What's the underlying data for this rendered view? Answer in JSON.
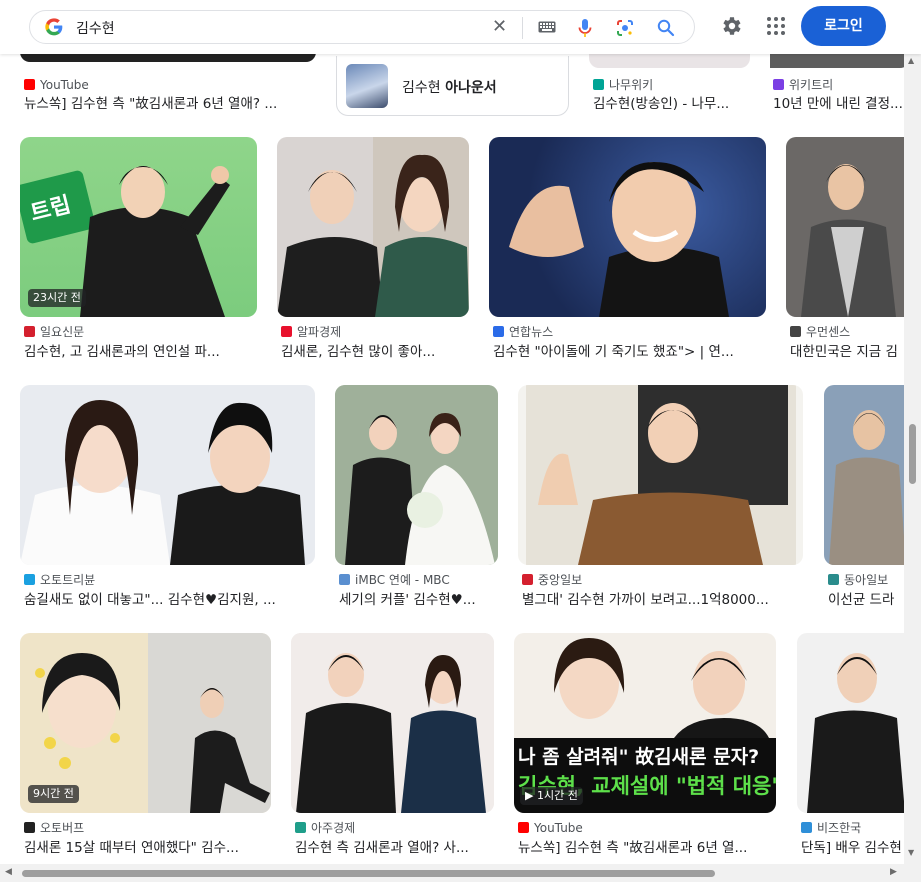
{
  "search": {
    "query": "김수현",
    "login_label": "로그인"
  },
  "related_card": {
    "name": "김수현",
    "suffix": "아나운서"
  },
  "tiles": [
    {
      "source": "YouTube",
      "title": "뉴스쏙] 김수현 측 \"故김새론과 6년 열애? ...",
      "fav_color": "#ff0000"
    },
    {
      "source": "나무위키",
      "title": "김수현(방송인) - 나무...",
      "fav_color": "#00a495"
    },
    {
      "source": "위키트리",
      "title": "10년 만에 내린 결정...",
      "fav_color": "#7b3fe4"
    },
    {
      "source": "일요신문",
      "title": "김수현, 고 김새론과의 연인설 파...",
      "fav_color": "#d4202e",
      "badge": "23시간 전"
    },
    {
      "source": "알파경제",
      "title": "김새론, 김수현 많이 좋아...",
      "fav_color": "#e8112d"
    },
    {
      "source": "연합뉴스",
      "title": "김수현 \"아이돌에 기 죽기도 했죠\"> | 연...",
      "fav_color": "#2b6be8"
    },
    {
      "source": "우먼센스",
      "title": "대한민국은 지금 김",
      "fav_color": "#444444"
    },
    {
      "source": "오토트리뷴",
      "title": "숨길새도 없이 대놓고\"... 김수현♥김지원, ...",
      "fav_color": "#1aa0e0"
    },
    {
      "source": "iMBC 연예 - MBC",
      "title": "세기의 커플' 김수현♥...",
      "fav_color": "#5a8fd0"
    },
    {
      "source": "중앙일보",
      "title": "별그대' 김수현 가까이 보려고...1억8000...",
      "fav_color": "#d4202e"
    },
    {
      "source": "동아일보",
      "title": "이선균 드라",
      "fav_color": "#2a8c8c"
    },
    {
      "source": "오토버프",
      "title": "김새론 15살 때부터 연애했다\" 김수...",
      "fav_color": "#222222",
      "badge": "9시간 전"
    },
    {
      "source": "아주경제",
      "title": "김수현 측 김새론과 열애? 사...",
      "fav_color": "#1f9e8a"
    },
    {
      "source": "YouTube",
      "title": "뉴스쏙] 김수현 측 \"故김새론과 6년 열...",
      "fav_color": "#ff0000",
      "badge": "1시간 전"
    },
    {
      "source": "비즈한국",
      "title": "단독] 배우 김수현",
      "fav_color": "#2f8fd8"
    }
  ],
  "thumb_texts": {
    "caption_top": "나 좀 살려줘\" 故김새론 문자?",
    "caption_bottom": "김수현, 교제설에 \"법적 대응\"",
    "sign_text": "트립"
  }
}
